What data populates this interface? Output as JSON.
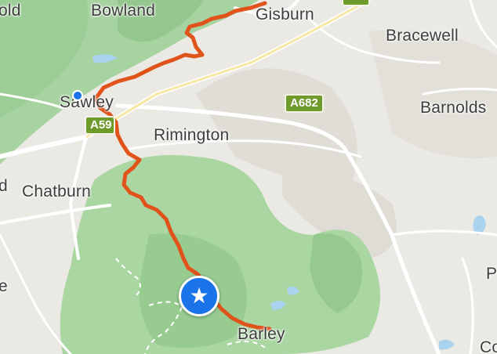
{
  "places": {
    "bowland": "Bowland",
    "gisburn": "Gisburn",
    "bracewell": "Bracewell",
    "sawley": "Sawley",
    "barnolds": "Barnolds",
    "rimington": "Rimington",
    "chatburn": "Chatburn",
    "barley": "Barley",
    "old": "old",
    "d": "d",
    "e": "e",
    "p": "P",
    "co": "Co"
  },
  "roads": {
    "a682": "A682",
    "a59": "A59"
  },
  "icons": {
    "destination": "star-icon",
    "location": "location-dot-icon"
  },
  "colors": {
    "route": "#e0541b",
    "pin": "#1a73e8",
    "road_shield": "#6f9a2c"
  }
}
